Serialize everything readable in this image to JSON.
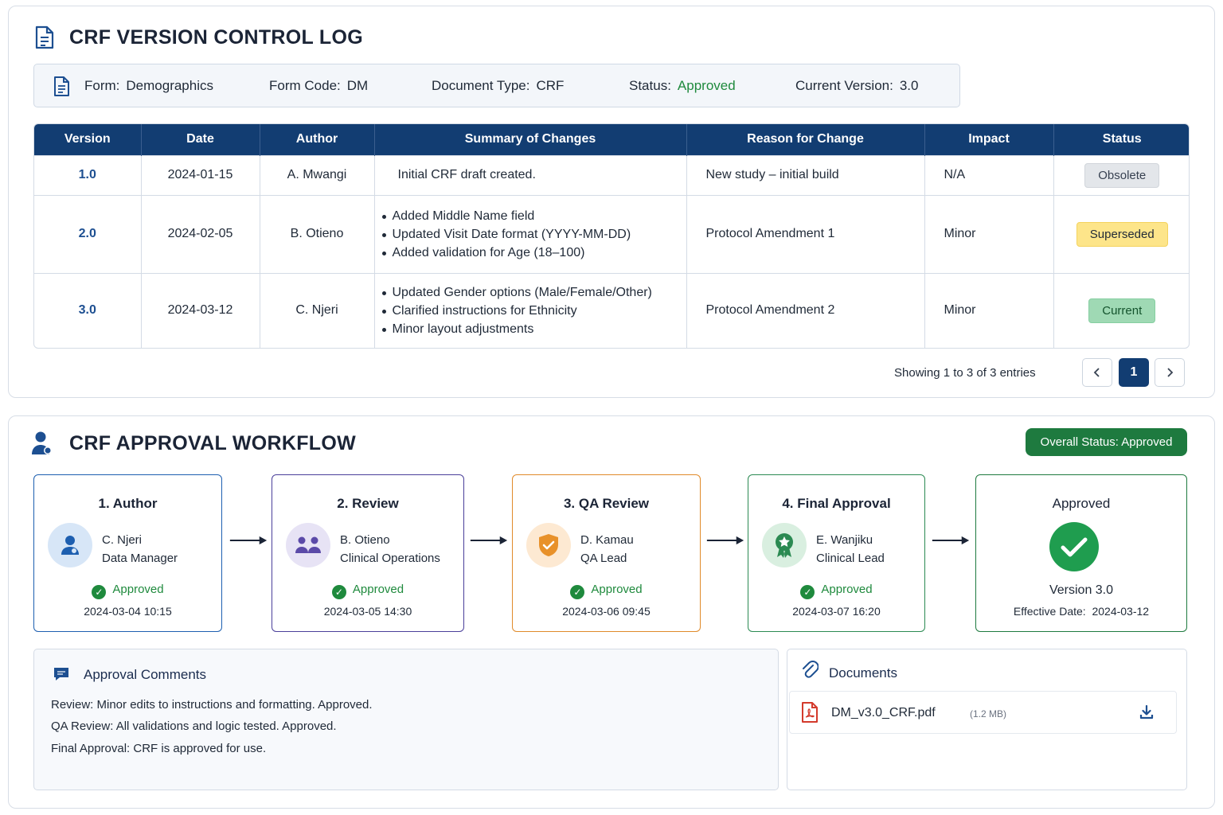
{
  "version_log": {
    "title": "CRF VERSION CONTROL LOG",
    "info": {
      "form_label": "Form:",
      "form_value": "Demographics",
      "code_label": "Form Code:",
      "code_value": "DM",
      "type_label": "Document Type:",
      "type_value": "CRF",
      "status_label": "Status:",
      "status_value": "Approved",
      "version_label": "Current Version:",
      "version_value": "3.0"
    },
    "columns": [
      "Version",
      "Date",
      "Author",
      "Summary of Changes",
      "Reason for Change",
      "Impact",
      "Status"
    ],
    "rows": [
      {
        "version": "1.0",
        "date": "2024-01-15",
        "author": "A. Mwangi",
        "summary": [
          "Initial CRF draft created."
        ],
        "reason": "New study – initial build",
        "impact": "N/A",
        "status": "Obsolete"
      },
      {
        "version": "2.0",
        "date": "2024-02-05",
        "author": "B. Otieno",
        "summary": [
          "Added Middle Name field",
          "Updated Visit Date format (YYYY-MM-DD)",
          "Added validation for Age (18–100)"
        ],
        "reason": "Protocol Amendment 1",
        "impact": "Minor",
        "status": "Superseded"
      },
      {
        "version": "3.0",
        "date": "2024-03-12",
        "author": "C. Njeri",
        "summary": [
          "Updated Gender options (Male/Female/Other)",
          "Clarified instructions for Ethnicity",
          "Minor layout adjustments"
        ],
        "reason": "Protocol Amendment 2",
        "impact": "Minor",
        "status": "Current"
      }
    ],
    "pagination": {
      "text": "Showing 1 to 3 of 3 entries",
      "current_page": "1",
      "prev": "‹",
      "next": "›"
    }
  },
  "workflow": {
    "title": "CRF APPROVAL WORKFLOW",
    "overall_status": "Overall Status: Approved",
    "steps": [
      {
        "title": "1. Author",
        "name": "C. Njeri",
        "role": "Data Manager",
        "status": "Approved",
        "datetime": "2024-03-04 10:15",
        "icon": "user-icon"
      },
      {
        "title": "2. Review",
        "name": "B. Otieno",
        "role": "Clinical Operations",
        "status": "Approved",
        "datetime": "2024-03-05 14:30",
        "icon": "users-icon"
      },
      {
        "title": "3. QA Review",
        "name": "D. Kamau",
        "role": "QA Lead",
        "status": "Approved",
        "datetime": "2024-03-06 09:45",
        "icon": "shield-check-icon"
      },
      {
        "title": "4. Final Approval",
        "name": "E. Wanjiku",
        "role": "Clinical Lead",
        "status": "Approved",
        "datetime": "2024-03-07 16:20",
        "icon": "award-icon"
      }
    ],
    "final": {
      "title": "Approved",
      "version": "Version 3.0",
      "effective_label": "Effective Date:",
      "effective_date": "2024-03-12"
    },
    "colors": {
      "author": "#1d5fb0",
      "review": "#4a3f9a",
      "qa": "#e08a2a",
      "final_approval": "#2b8a52",
      "approved": "#1e7a3f"
    }
  },
  "comments": {
    "title": "Approval Comments",
    "lines": [
      "Review:  Minor edits to instructions and formatting.  Approved.",
      "QA Review:  All validations and logic tested.  Approved.",
      "Final Approval:  CRF is approved for use."
    ]
  },
  "documents": {
    "title": "Documents",
    "files": [
      {
        "name": "DM_v3.0_CRF.pdf",
        "size": "(1.2 MB)"
      }
    ]
  }
}
